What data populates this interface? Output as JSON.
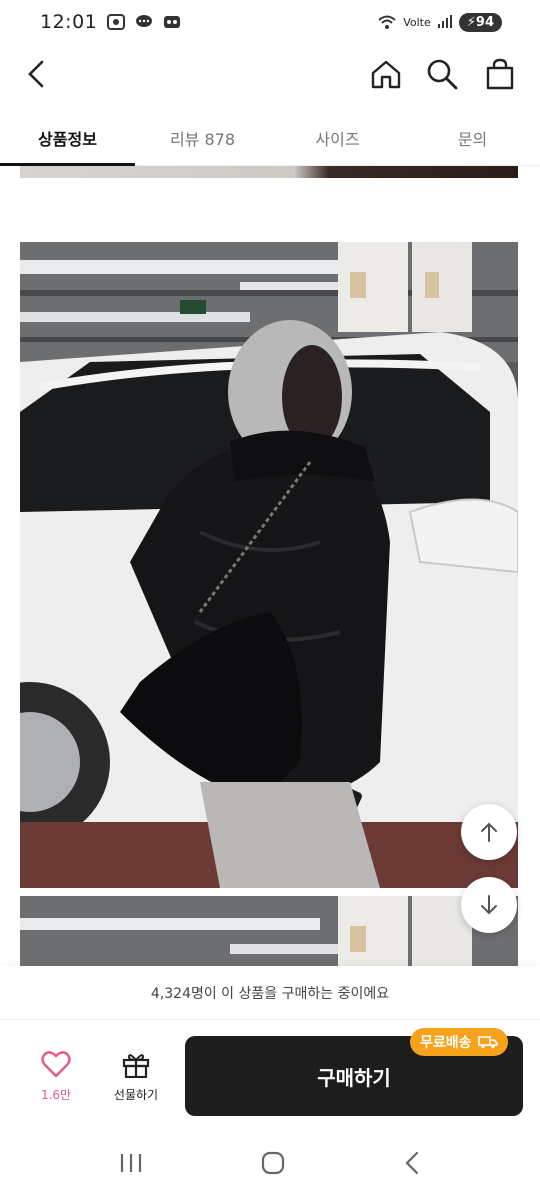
{
  "status_bar": {
    "time": "12:01",
    "network": "Volte",
    "battery": "94"
  },
  "nav": {
    "back_icon": "chevron-left-icon",
    "home_icon": "home-icon",
    "search_icon": "search-icon",
    "cart_icon": "shopping-bag-icon"
  },
  "tabs": [
    {
      "label": "상품정보",
      "active": true
    },
    {
      "label": "리뷰 878",
      "active": false
    },
    {
      "label": "사이즈",
      "active": false
    },
    {
      "label": "문의",
      "active": false
    }
  ],
  "buyers_text": "4,324명이 이 상품을 구매하는 중이에요",
  "actions": {
    "like_count": "1.6만",
    "gift_label": "선물하기",
    "buy_label": "구매하기",
    "free_shipping": "무료배송"
  },
  "colors": {
    "accent_pink": "#e45a80",
    "badge_orange": "#f6a21b",
    "buy_button": "#1d1d1d"
  }
}
